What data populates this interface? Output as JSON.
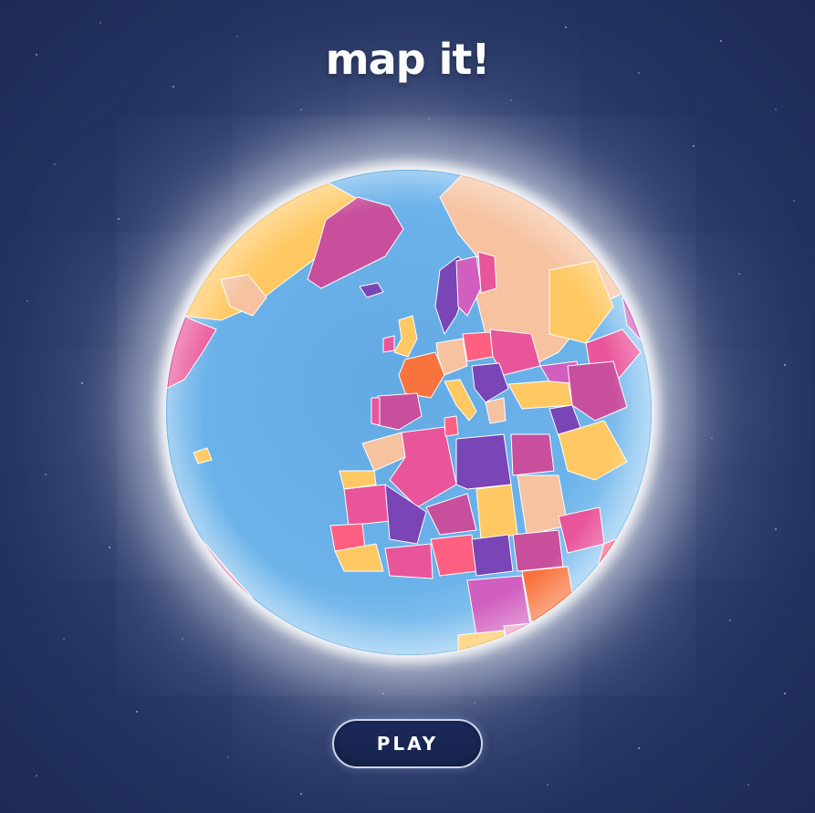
{
  "title": "map it!",
  "play_button": {
    "label": "PLAY"
  },
  "colors": {
    "background": "#2a3a6a",
    "ocean": "#6aaee6",
    "land_palette": [
      "#ffc862",
      "#e9559a",
      "#7a45b6",
      "#f6c2a0",
      "#ff5f80",
      "#c84f9c",
      "#f8733d",
      "#d15fc0",
      "#f5a0c4"
    ]
  }
}
